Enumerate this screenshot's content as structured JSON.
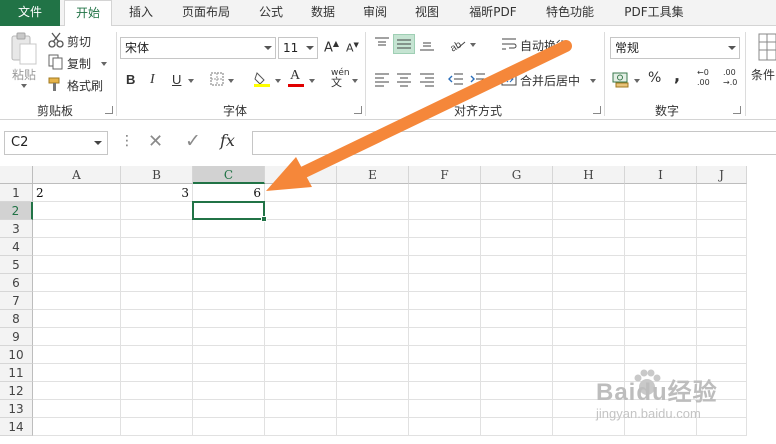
{
  "tabs": [
    {
      "label": "文件",
      "state": "file"
    },
    {
      "label": "开始",
      "state": "active"
    },
    {
      "label": "插入",
      "state": ""
    },
    {
      "label": "页面布局",
      "state": ""
    },
    {
      "label": "公式",
      "state": ""
    },
    {
      "label": "数据",
      "state": ""
    },
    {
      "label": "审阅",
      "state": ""
    },
    {
      "label": "视图",
      "state": ""
    },
    {
      "label": "福昕PDF",
      "state": ""
    },
    {
      "label": "特色功能",
      "state": ""
    },
    {
      "label": "PDF工具集",
      "state": ""
    }
  ],
  "ribbon": {
    "clipboard": {
      "paste": "粘贴",
      "cut": "剪切",
      "copy": "复制",
      "format_painter": "格式刷",
      "group": "剪贴板"
    },
    "font": {
      "family": "宋体",
      "size": "11",
      "bold": "B",
      "italic": "I",
      "underline": "U",
      "grow": "A",
      "shrink": "A",
      "phonetic_top": "wén",
      "phonetic_bottom": "文",
      "font_color_letter": "A",
      "group": "字体",
      "fill_color": "#ffff00",
      "font_color": "#e00000"
    },
    "alignment": {
      "wrap_text": "自动换行",
      "merge_center": "合并后居中",
      "group": "对齐方式"
    },
    "number": {
      "format": "常规",
      "percent": "%",
      "comma": ",",
      "increase_decimal_top": "←0",
      "increase_decimal_bottom": ".00",
      "decrease_decimal_top": ".00",
      "decrease_decimal_bottom": "→.0",
      "group": "数字"
    },
    "styles": {
      "conditional": "条件"
    }
  },
  "formula_bar": {
    "name_box": "C2",
    "cancel_glyph": "✕",
    "enter_glyph": "✓",
    "fx": "fx",
    "value": ""
  },
  "sheet": {
    "columns": [
      "A",
      "B",
      "C",
      "D",
      "E",
      "F",
      "G",
      "H",
      "I",
      "J"
    ],
    "selected_column": "C",
    "rows": [
      "1",
      "2",
      "3",
      "4",
      "5",
      "6",
      "7",
      "8",
      "9",
      "10",
      "11",
      "12",
      "13",
      "14"
    ],
    "selected_row": "2",
    "cells": [
      {
        "ref": "A1",
        "value": "2",
        "align": "left"
      },
      {
        "ref": "B1",
        "value": "3",
        "align": "right"
      },
      {
        "ref": "C1",
        "value": "6",
        "align": "right"
      }
    ],
    "selected_cell": "C2"
  },
  "overlay": {
    "arrow_color": "#f5873a",
    "watermark_brand": "Baidu经验",
    "watermark_url": "jingyan.baidu.com"
  },
  "colors": {
    "accent": "#217346",
    "selected_header_bg": "#d2d2d2"
  }
}
